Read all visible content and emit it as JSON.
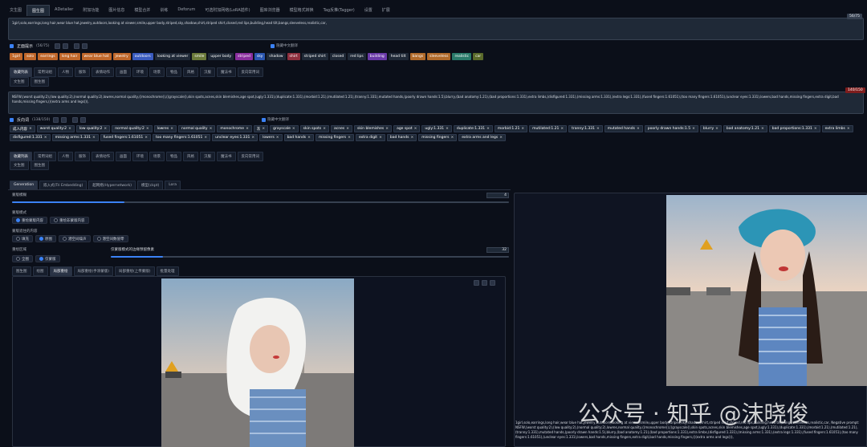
{
  "top_tabs": [
    "文生图",
    "图生图",
    "ADetailer",
    "附加功能",
    "图片信息",
    "模型合并",
    "训练",
    "Deforum",
    "可选附加网络(LoRA插件)",
    "图库浏览器",
    "模型格式转换",
    "Tag反推(Tagger)",
    "设置",
    "扩展"
  ],
  "active_top_tab_index": 1,
  "positive": {
    "counter": "56/75",
    "text": "1girl,solo,earrings,long hair,wear blue hat,jewelry,outdoors,looking at viewer,smile,upper body,striped,sky,shadow,shirt,striped shirt,closed,red lips,building,head tilt,bangs,sleeveless,realistic,car,",
    "section_label": "正面提示",
    "section_count": "(56/75)",
    "toggle_label": "隐藏中文翻译",
    "tokens": [
      {
        "t": "1girl",
        "c": "#c0672a"
      },
      {
        "t": "solo",
        "c": "#c0672a"
      },
      {
        "t": "earrings",
        "c": "#c0672a"
      },
      {
        "t": "long hair",
        "c": "#c0672a"
      },
      {
        "t": "wear blue hat",
        "c": "#c0672a"
      },
      {
        "t": "jewelry",
        "c": "#c0672a"
      },
      {
        "t": "outdoors",
        "c": "#3a5bbf"
      },
      {
        "t": "looking at viewer",
        "c": "#1f2937"
      },
      {
        "t": "smile",
        "c": "#6b7a3a"
      },
      {
        "t": "upper body",
        "c": "#1f2937"
      },
      {
        "t": "striped",
        "c": "#8a2f9e"
      },
      {
        "t": "sky",
        "c": "#2a56b0"
      },
      {
        "t": "shadow",
        "c": "#1f2937"
      },
      {
        "t": "shirt",
        "c": "#8e2f3e"
      },
      {
        "t": "striped shirt",
        "c": "#1f2937"
      },
      {
        "t": "closed",
        "c": "#1f2937"
      },
      {
        "t": "red lips",
        "c": "#1f2937"
      },
      {
        "t": "building",
        "c": "#6a3aa8"
      },
      {
        "t": "head tilt",
        "c": "#1f2937"
      },
      {
        "t": "bangs",
        "c": "#b06a2a"
      },
      {
        "t": "sleeveless",
        "c": "#b06a2a"
      },
      {
        "t": "realistic",
        "c": "#2a7a6a"
      },
      {
        "t": "car",
        "c": "#5a6a2a"
      }
    ],
    "sub_tabs": [
      "收藏列表",
      "常用词组",
      "人物",
      "服饰",
      "表情动作",
      "画面",
      "环境",
      "场景",
      "物品",
      "风格",
      "汉服",
      "魔法书",
      "反向常用词"
    ],
    "extra_tabs": [
      "文生图",
      "图生图"
    ]
  },
  "negative": {
    "counter": "140/150",
    "text": "NSFW,(worst quality:2),(low quality:2),(normal quality:2),lowres,normal quality,((monochrome)),((grayscale)),skin spots,acnes,skin blemishes,age spot,(ugly:1.331),(duplicate:1.331),(morbid:1.21),(mutilated:1.21),(tranny:1.331),mutated hands,(poorly drawn hands:1.5),blurry,(bad anatomy:1.21),(bad proportions:1.331),extra limbs,(disfigured:1.331),(missing arms:1.331),(extra legs:1.331),(fused fingers:1.61051),(too many fingers:1.61051),(unclear eyes:1.331),lowers,bad hands,missing fingers,extra digit,bad hands,missing fingers,(((extra arms and legs))),",
    "section_label": "反向词",
    "section_count": "(138/150)",
    "toggle_label": "隐藏中文翻译",
    "tokens": [
      "成人内容",
      "worst quality:2",
      "low quality:2",
      "normal quality:2",
      "lowres",
      "normal quality",
      "monochrome",
      "灰",
      "grayscale",
      "skin spots",
      "acnes",
      "skin blemishes",
      "age spot",
      "ugly:1.331",
      "duplicate:1.331",
      "morbid:1.21",
      "mutilated:1.21",
      "tranny:1.331",
      "mutated hands",
      "poorly drawn hands:1.5",
      "blurry",
      "bad anatomy:1.21",
      "bad proportions:1.331",
      "extra limbs",
      "disfigured:1.331",
      "missing arms:1.331",
      "fused fingers:1.61051",
      "too many fingers:1.61051",
      "unclear eyes:1.331",
      "lowers",
      "bad hands",
      "missing fingers",
      "extra digit",
      "bad hands",
      "missing fingers",
      "extra arms and legs"
    ],
    "sub_tabs": [
      "收藏列表",
      "常用词组",
      "人物",
      "服饰",
      "表情动作",
      "画面",
      "环境",
      "场景",
      "物品",
      "风格",
      "汉服",
      "魔法书",
      "反向常用词"
    ],
    "extra_tabs": [
      "文生图",
      "图生图"
    ]
  },
  "gen_tabs": [
    "Generation",
    "嵌入式(Tri Embedding)",
    "超网络(Hypernetwork)",
    "模型(ckpt)",
    "Lora"
  ],
  "settings": {
    "mask_blur_label": "蒙版模糊",
    "mask_blur_value": "4",
    "mask_mode_label": "蒙版模式",
    "mask_mode_options": [
      "重绘蒙版内容",
      "重绘非蒙版内容"
    ],
    "fill_label": "蒙版遮住的内容",
    "fill_options": [
      "填充",
      "原图",
      "潜空间噪声",
      "潜空间数值零"
    ],
    "area_label": "重绘区域",
    "area_options": [
      "全图",
      "仅蒙版"
    ],
    "padding_label": "仅蒙版模式的边缘预留像素",
    "padding_value": "32"
  },
  "img_tabs": [
    "图生图",
    "绘图",
    "局部重绘",
    "局部重绘(手涂蒙版)",
    "局部重绘(上传蒙版)",
    "批量处理"
  ],
  "output_caption": "1girl,solo,earrings,long hair,wear blue hat,jewelry,outdoors,looking at viewer,smile,upper body,striped,sky,shadow,shirt,striped shirt,closed,red lips,building,head tilt,bangs,sleeveless,realistic,car, Negative prompt: NSFW,(worst quality:2),(low quality:2),(normal quality:2),lowres,normal quality,((monochrome)),((grayscale)),skin spots,acnes,skin blemishes,age spot,(ugly:1.331),(duplicate:1.331),(morbid:1.21),(mutilated:1.21),(tranny:1.331),mutated hands,(poorly drawn hands:1.5),blurry,(bad anatomy:1.21),(bad proportions:1.331),extra limbs,(disfigured:1.331),(missing arms:1.331),(extra legs:1.331),(fused fingers:1.61051),(too many fingers:1.61051),(unclear eyes:1.331),lowers,bad hands,missing fingers,extra digit,bad hands,missing fingers,(((extra arms and legs))),",
  "watermark": "公众号 · 知乎 @沫晓俊",
  "icons": [
    "pencil-icon",
    "trash-icon",
    "star-icon",
    "paste-icon",
    "close-icon",
    "undo-icon"
  ]
}
